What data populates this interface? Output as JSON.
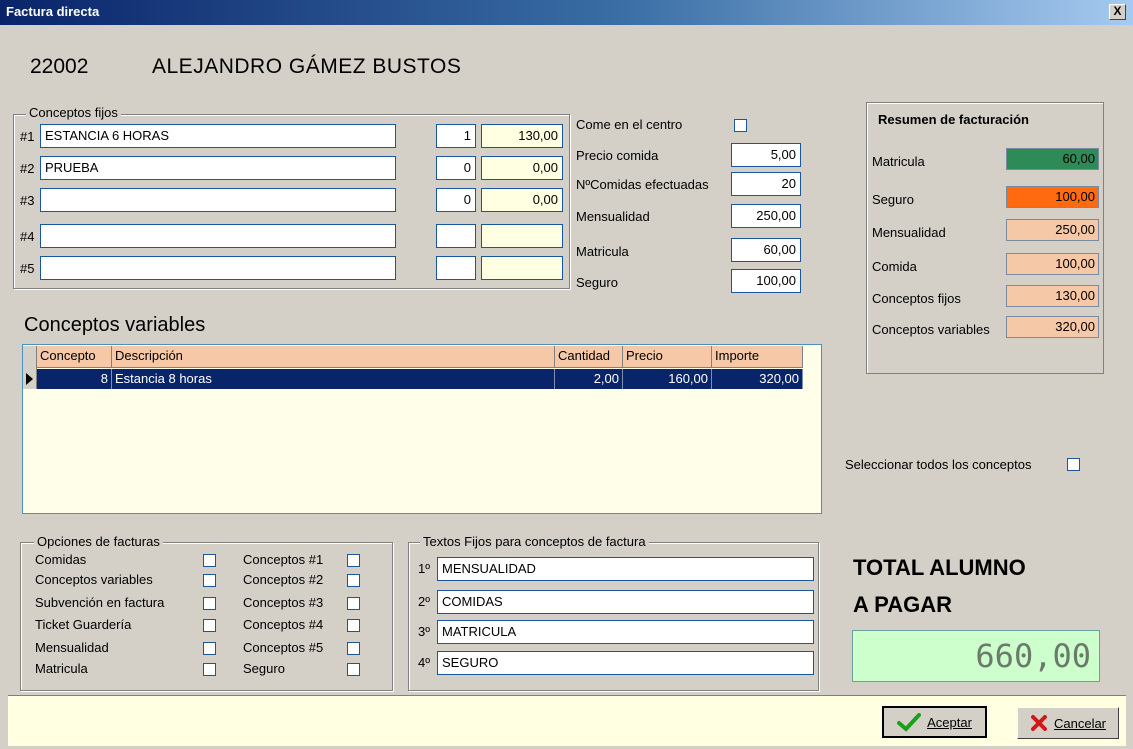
{
  "window": {
    "title": "Factura directa",
    "close_label": "X"
  },
  "header": {
    "code": "22002",
    "name": "ALEJANDRO GÁMEZ BUSTOS"
  },
  "conceptos_fijos": {
    "label": "Conceptos fijos",
    "rows": [
      {
        "tag": "#1",
        "text": "ESTANCIA 6 HORAS",
        "qty": "1",
        "amount": "130,00"
      },
      {
        "tag": "#2",
        "text": "PRUEBA",
        "qty": "0",
        "amount": "0,00"
      },
      {
        "tag": "#3",
        "text": "",
        "qty": "0",
        "amount": "0,00"
      },
      {
        "tag": "#4",
        "text": "",
        "qty": "",
        "amount": ""
      },
      {
        "tag": "#5",
        "text": "",
        "qty": "",
        "amount": ""
      }
    ]
  },
  "comida": {
    "come_label": "Come en el centro",
    "precio_label": "Precio comida",
    "precio_value": "5,00",
    "ncomidas_label": "NºComidas efectuadas",
    "ncomidas_value": "20",
    "mensualidad_label": "Mensualidad",
    "mensualidad_value": "250,00",
    "matricula_label": "Matricula",
    "matricula_value": "60,00",
    "seguro_label": "Seguro",
    "seguro_value": "100,00"
  },
  "resumen": {
    "title": "Resumen de facturación",
    "rows": [
      {
        "label": "Matricula",
        "value": "60,00",
        "color": "#2e8b57"
      },
      {
        "label": "Seguro",
        "value": "100,00",
        "color": "#ff6a10"
      },
      {
        "label": "Mensualidad",
        "value": "250,00",
        "color": "#f5c8a8"
      },
      {
        "label": "Comida",
        "value": "100,00",
        "color": "#f5c8a8"
      },
      {
        "label": "Conceptos fijos",
        "value": "130,00",
        "color": "#f5c8a8"
      },
      {
        "label": "Conceptos variables",
        "value": "320,00",
        "color": "#f5c8a8"
      }
    ]
  },
  "variables": {
    "title": "Conceptos variables",
    "columns": [
      "Concepto",
      "Descripción",
      "Cantidad",
      "Precio",
      "Importe"
    ],
    "rows": [
      {
        "concepto": "8",
        "descripcion": "Estancia 8 horas",
        "cantidad": "2,00",
        "precio": "160,00",
        "importe": "320,00"
      }
    ]
  },
  "seleccionar_todos_label": "Seleccionar todos los conceptos",
  "opciones": {
    "label": "Opciones de facturas",
    "left": [
      "Comidas",
      "Conceptos variables",
      "Subvención en factura",
      "Ticket Guardería",
      "Mensualidad",
      "Matricula"
    ],
    "right": [
      "Conceptos #1",
      "Conceptos #2",
      "Conceptos #3",
      "Conceptos #4",
      "Conceptos #5",
      "Seguro"
    ]
  },
  "textos_fijos": {
    "label": "Textos Fijos  para conceptos de factura",
    "rows": [
      {
        "tag": "1º",
        "value": "MENSUALIDAD"
      },
      {
        "tag": "2º",
        "value": "COMIDAS"
      },
      {
        "tag": "3º",
        "value": "MATRICULA"
      },
      {
        "tag": "4º",
        "value": "SEGURO"
      }
    ]
  },
  "total": {
    "label_line1": "TOTAL ALUMNO",
    "label_line2": "A PAGAR",
    "value": "660,00"
  },
  "buttons": {
    "aceptar": "Aceptar",
    "cancelar": "Cancelar"
  }
}
